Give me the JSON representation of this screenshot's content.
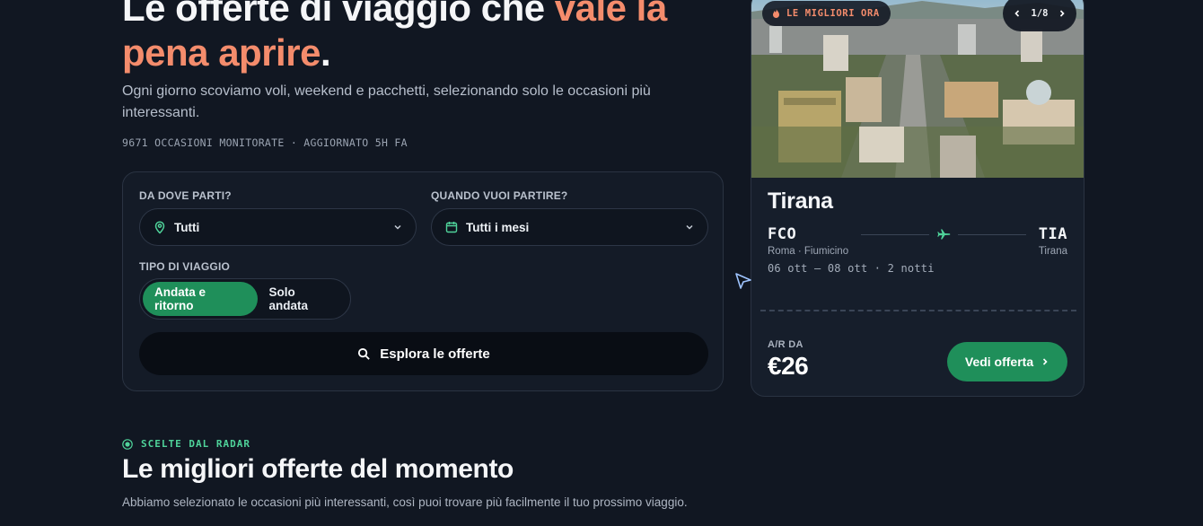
{
  "hero": {
    "title_main": "Le offerte di viaggio che ",
    "title_accent": "vale la pena aprire",
    "title_end": ".",
    "subtitle": "Ogni giorno scoviamo voli, weekend e pacchetti, selezionando solo le occasioni più interessanti.",
    "meta": "9671 OCCASIONI MONITORATE · AGGIORNATO 5H FA"
  },
  "search": {
    "from_label": "DA DOVE PARTI?",
    "from_value": "Tutti",
    "from_icon": "location-pin-icon",
    "when_label": "QUANDO VUOI PARTIRE?",
    "when_value": "Tutti i mesi",
    "when_icon": "calendar-icon",
    "trip_type_label": "TIPO DI VIAGGIO",
    "trip_options": [
      "Andata e ritorno",
      "Solo andata"
    ],
    "trip_selected": "Andata e ritorno",
    "explore_label": "Esplora le offerte"
  },
  "deal_card": {
    "badge": "LE MIGLIORI ORA",
    "pager": "1/8",
    "city": "Tirana",
    "from_code": "FCO",
    "from_airport": "Roma · Fiumicino",
    "to_code": "TIA",
    "to_airport": "Tirana",
    "dates": "06 ott – 08 ott · 2 notti",
    "price_label": "A/R DA",
    "price": "€26",
    "cta": "Vedi offerta"
  },
  "section": {
    "eyebrow": "SCELTE DAL RADAR",
    "title": "Le migliori offerte del momento",
    "subtitle": "Abbiamo selezionato le occasioni più interessanti, così puoi trovare più facilmente il tuo prossimo viaggio."
  },
  "colors": {
    "background": "#111722",
    "accent_orange": "#f48c6c",
    "accent_green": "#1f8f5a",
    "green_text": "#4fd39a"
  }
}
